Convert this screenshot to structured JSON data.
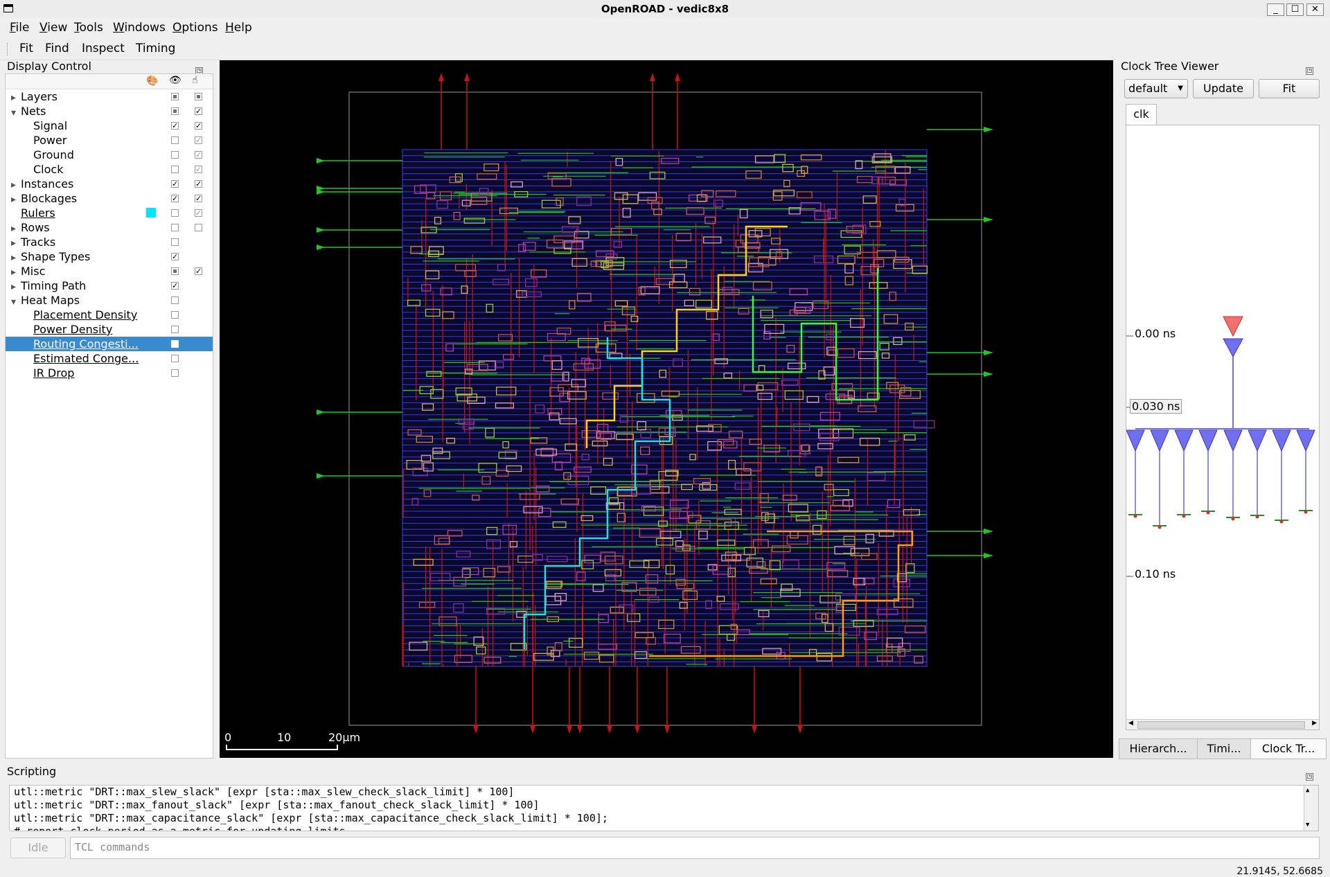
{
  "window": {
    "title": "OpenROAD - vedic8x8"
  },
  "menubar": [
    {
      "label": "File",
      "accel": "F",
      "rest": "ile"
    },
    {
      "label": "View",
      "accel": "V",
      "rest": "iew"
    },
    {
      "label": "Tools",
      "accel": "T",
      "rest": "ools"
    },
    {
      "label": "Windows",
      "accel": "W",
      "rest": "indows"
    },
    {
      "label": "Options",
      "accel": "O",
      "rest": "ptions"
    },
    {
      "label": "Help",
      "accel": "H",
      "rest": "elp"
    }
  ],
  "toolbar": {
    "fit": "Fit",
    "find": "Find",
    "inspect": "Inspect",
    "timing": "Timing"
  },
  "display_control": {
    "title": "Display Control",
    "items": [
      {
        "label": "Layers",
        "indent": 0,
        "arrow": "right",
        "visible": "partial",
        "selectable": "partial"
      },
      {
        "label": "Nets",
        "indent": 0,
        "arrow": "down",
        "visible": "partial",
        "selectable": "checked"
      },
      {
        "label": "Signal",
        "indent": 1,
        "visible": "checked",
        "selectable": "checked"
      },
      {
        "label": "Power",
        "indent": 1,
        "visible": "unchecked",
        "selectable": "checked-gray"
      },
      {
        "label": "Ground",
        "indent": 1,
        "visible": "unchecked",
        "selectable": "checked-gray"
      },
      {
        "label": "Clock",
        "indent": 1,
        "visible": "unchecked",
        "selectable": "checked-gray"
      },
      {
        "label": "Instances",
        "indent": 0,
        "arrow": "right",
        "visible": "checked",
        "selectable": "checked"
      },
      {
        "label": "Blockages",
        "indent": 0,
        "arrow": "right",
        "visible": "checked",
        "selectable": "checked"
      },
      {
        "label": "Rulers",
        "indent": 0,
        "color": "#00e5ff",
        "link": true,
        "visible": "unchecked",
        "selectable": "checked-gray"
      },
      {
        "label": "Rows",
        "indent": 0,
        "arrow": "right",
        "visible": "unchecked",
        "selectable": "unchecked"
      },
      {
        "label": "Tracks",
        "indent": 0,
        "arrow": "right",
        "visible": "unchecked"
      },
      {
        "label": "Shape Types",
        "indent": 0,
        "arrow": "right",
        "visible": "checked"
      },
      {
        "label": "Misc",
        "indent": 0,
        "arrow": "right",
        "visible": "partial",
        "selectable": "checked"
      },
      {
        "label": "Timing Path",
        "indent": 0,
        "arrow": "right",
        "visible": "checked"
      },
      {
        "label": "Heat Maps",
        "indent": 0,
        "arrow": "down",
        "visible": "unchecked"
      },
      {
        "label": "Placement Density",
        "indent": 1,
        "link": true,
        "visible": "unchecked"
      },
      {
        "label": "Power Density",
        "indent": 1,
        "link": true,
        "visible": "unchecked"
      },
      {
        "label": "Routing Congesti...",
        "indent": 1,
        "link": true,
        "selected": true,
        "visible": "unchecked"
      },
      {
        "label": "Estimated Conge...",
        "indent": 1,
        "link": true,
        "visible": "unchecked"
      },
      {
        "label": "IR Drop",
        "indent": 1,
        "link": true,
        "visible": "unchecked"
      }
    ]
  },
  "layout_view": {
    "scale_labels": [
      "0",
      "10",
      "20µm"
    ]
  },
  "clock_tree_viewer": {
    "title": "Clock Tree Viewer",
    "corner": "default",
    "update_button": "Update",
    "fit_button": "Fit",
    "clock_tab": "clk",
    "time_labels": [
      "0.00 ns",
      "0.030 ns",
      "0.10 ns"
    ],
    "bottom_tabs": [
      "Hierarch...",
      "Timi...",
      "Clock Tr..."
    ]
  },
  "scripting": {
    "title": "Scripting",
    "lines": [
      "utl::metric \"DRT::max_slew_slack\" [expr [sta::max_slew_check_slack_limit] * 100]",
      "utl::metric \"DRT::max_fanout_slack\" [expr [sta::max_fanout_check_slack_limit] * 100]",
      "utl::metric \"DRT::max_capacitance_slack\" [expr [sta::max_capacitance_check_slack_limit] * 100];",
      "# report clock period as a metric for updating limits"
    ],
    "idle_button": "Idle",
    "input_placeholder": "TCL commands"
  },
  "status": {
    "coordinates": "21.9145, 52.6685"
  }
}
